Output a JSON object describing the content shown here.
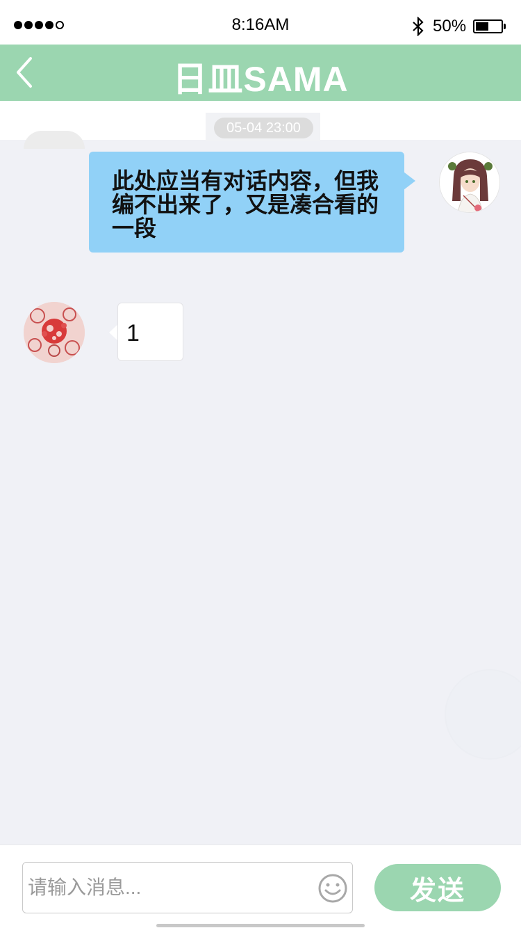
{
  "status_bar": {
    "time": "8:16AM",
    "battery_percent": "50%",
    "battery_level": 0.5,
    "signal_dots_filled": 4,
    "signal_dots_total": 5
  },
  "nav": {
    "title": "日皿SAMA",
    "back_icon": "chevron-left-icon"
  },
  "chat": {
    "timestamp": "05-04 23:00",
    "messages": [
      {
        "sender": "me",
        "avatar_icon": "anime-girl-avatar",
        "lines": [
          "此处应当有对话内容，但我",
          "编不出来了，又是凑合看的",
          "一段"
        ]
      },
      {
        "sender": "other",
        "avatar_icon": "red-pattern-avatar",
        "text": "1"
      }
    ]
  },
  "input_bar": {
    "placeholder": "请输入消息...",
    "value": "",
    "emoji_icon": "smiley-icon",
    "send_label": "发送"
  },
  "colors": {
    "accent_green": "#9bd6b0",
    "outgoing_bubble": "#91d1f7",
    "chat_background": "#f0f1f6"
  }
}
